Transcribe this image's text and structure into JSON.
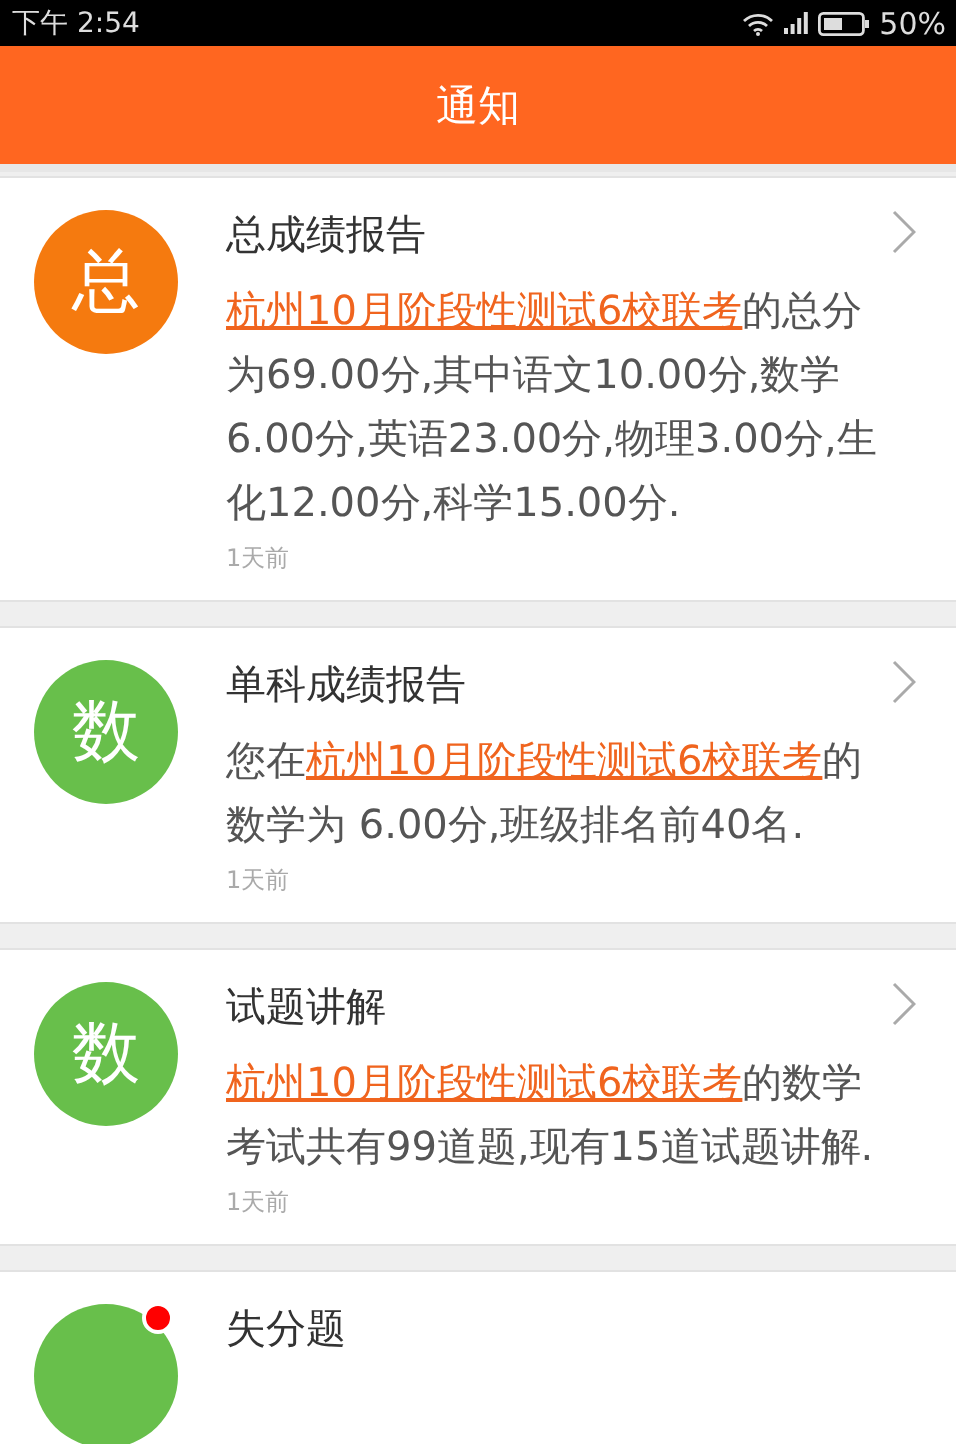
{
  "status_bar": {
    "time": "下午 2:54",
    "battery": "50%"
  },
  "header": {
    "title": "通知"
  },
  "notifications": [
    {
      "avatar": {
        "text": "总",
        "color": "#f57a0f"
      },
      "unread": false,
      "title": "总成绩报告",
      "body": {
        "link": "杭州10月阶段性测试6校联考",
        "after": "的总分为69.00分,其中语文10.00分,数学6.00分,英语23.00分,物理3.00分,生化12.00分,科学15.00分."
      },
      "time": "1天前"
    },
    {
      "avatar": {
        "text": "数",
        "color": "#68bf4b"
      },
      "unread": false,
      "title": "单科成绩报告",
      "body": {
        "before": "您在",
        "link": "杭州10月阶段性测试6校联考",
        "after": "的数学为 6.00分,班级排名前40名."
      },
      "time": "1天前"
    },
    {
      "avatar": {
        "text": "数",
        "color": "#68bf4b"
      },
      "unread": false,
      "title": "试题讲解",
      "body": {
        "link": "杭州10月阶段性测试6校联考",
        "after": "的数学考试共有99道题,现有15道试题讲解."
      },
      "time": "1天前"
    },
    {
      "avatar": {
        "color": "#68bf4b"
      },
      "unread": true,
      "title": "失分题"
    }
  ]
}
